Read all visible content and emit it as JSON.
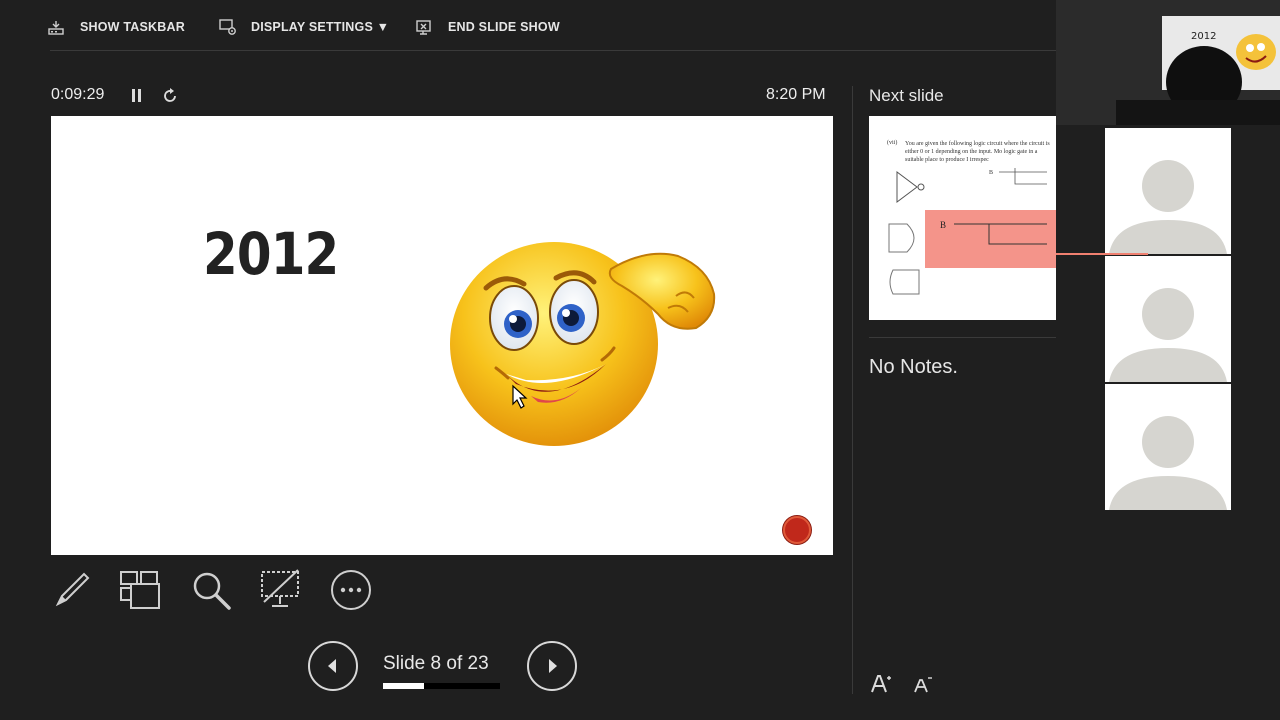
{
  "toolbar": {
    "show_taskbar": "SHOW TASKBAR",
    "display_settings": "DISPLAY SETTINGS ▼",
    "end_slide_show": "END SLIDE SHOW"
  },
  "presenter": {
    "elapsed_time": "0:09:29",
    "clock": "8:20 PM"
  },
  "current_slide": {
    "year_text": "2012"
  },
  "tools": [
    "pen-tool",
    "see-all-slides",
    "zoom-into-slide",
    "toggle-black-screen",
    "more-options"
  ],
  "navigation": {
    "slide_counter": "Slide 8 of 23",
    "current": 8,
    "total": 23,
    "progress_fraction": 0.35
  },
  "next_slide": {
    "label": "Next slide",
    "question_number": "(vii)",
    "question_text": "You are given the following logic circuit where the circuit is either 0 or 1 depending on the input. Mo logic gate in a suitable place to produce I irrespec",
    "input_label": "B"
  },
  "notes": {
    "text": "No Notes."
  },
  "video": {
    "cam_slide_text": "2012"
  },
  "colors": {
    "background": "#1f1f1f",
    "record_dot": "#c0281b",
    "highlight": "#f4948a"
  }
}
